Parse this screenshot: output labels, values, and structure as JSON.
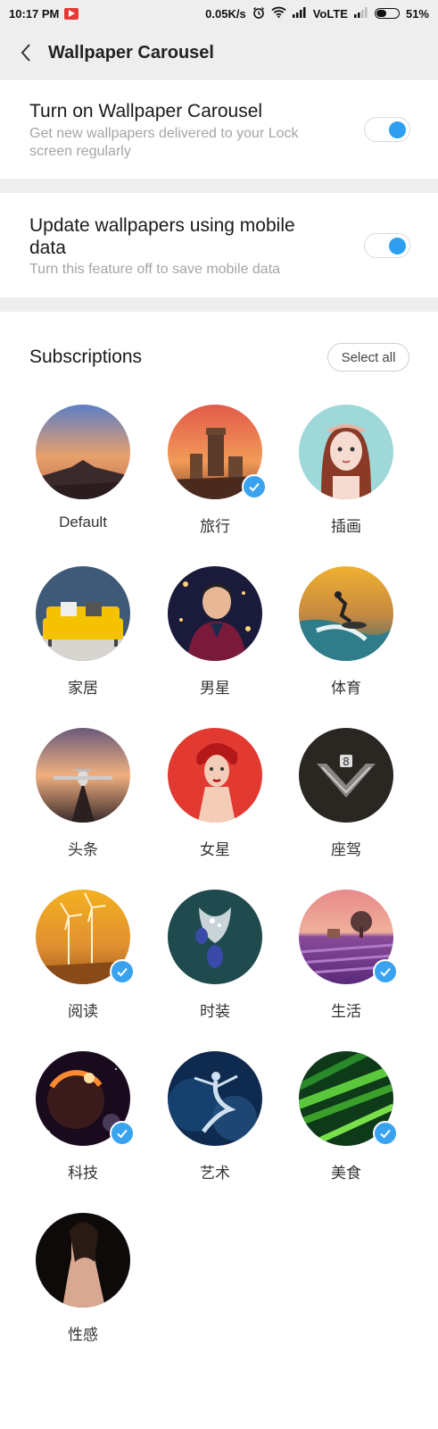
{
  "status_bar": {
    "time": "10:17 PM",
    "speed": "0.05K/s",
    "network": "VoLTE",
    "battery_percent": "51%",
    "battery_level": 0.51,
    "icons": [
      "youtube-icon",
      "alarm-icon",
      "wifi-icon",
      "signal-icon",
      "signal-weak-icon",
      "battery-icon"
    ]
  },
  "header": {
    "title": "Wallpaper Carousel",
    "back_icon": "chevron-left-icon"
  },
  "settings": {
    "carousel": {
      "title": "Turn on Wallpaper Carousel",
      "description": "Get new wallpapers delivered to your Lock screen regularly",
      "enabled": true
    },
    "mobile_data": {
      "title": "Update wallpapers using mobile data",
      "description": "Turn this feature off to save mobile data",
      "enabled": true
    }
  },
  "subscriptions": {
    "title": "Subscriptions",
    "select_all_label": "Select all",
    "accent_color": "#3aa3f0",
    "categories": [
      {
        "label": "Default",
        "checked": false,
        "thumb": "mountain-sunset"
      },
      {
        "label": "旅行",
        "checked": true,
        "thumb": "castle-sunset"
      },
      {
        "label": "插画",
        "checked": false,
        "thumb": "illustrated-girl"
      },
      {
        "label": "家居",
        "checked": false,
        "thumb": "yellow-sofa"
      },
      {
        "label": "男星",
        "checked": false,
        "thumb": "male-star"
      },
      {
        "label": "体育",
        "checked": false,
        "thumb": "surfer"
      },
      {
        "label": "头条",
        "checked": false,
        "thumb": "jet-runway"
      },
      {
        "label": "女星",
        "checked": false,
        "thumb": "female-star"
      },
      {
        "label": "座驾",
        "checked": false,
        "thumb": "car-grille"
      },
      {
        "label": "阅读",
        "checked": true,
        "thumb": "wind-turbines"
      },
      {
        "label": "时装",
        "checked": false,
        "thumb": "jewelry"
      },
      {
        "label": "生活",
        "checked": true,
        "thumb": "lavender-field"
      },
      {
        "label": "科技",
        "checked": true,
        "thumb": "planet-eclipse"
      },
      {
        "label": "艺术",
        "checked": false,
        "thumb": "dancer"
      },
      {
        "label": "美食",
        "checked": true,
        "thumb": "green-leaves"
      },
      {
        "label": "性感",
        "checked": false,
        "thumb": "woman-back"
      }
    ]
  }
}
